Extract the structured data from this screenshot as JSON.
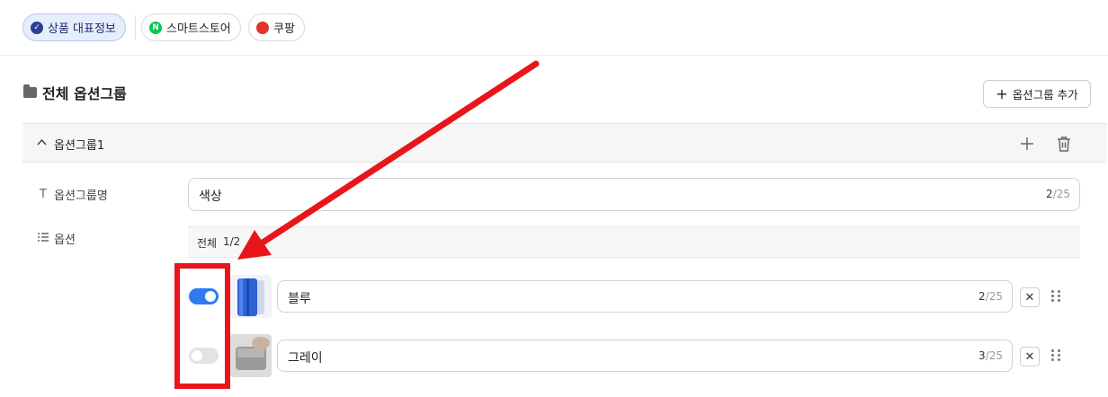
{
  "tabs": [
    {
      "label": "상품 대표정보",
      "icon": "check-circle-icon",
      "active": true
    },
    {
      "label": "스마트스토어",
      "icon": "naver-n-icon",
      "active": false
    },
    {
      "label": "쿠팡",
      "icon": "coupang-logo-icon",
      "active": false
    }
  ],
  "section": {
    "title": "전체 옵션그룹",
    "add_button": "옵션그룹 추가"
  },
  "group": {
    "name": "옵션그룹1"
  },
  "fields": {
    "name_label": "옵션그룹명",
    "options_label": "옵션",
    "name_value": "색상",
    "name_count": "2",
    "name_max": "/25"
  },
  "options_list": {
    "all_label": "전체",
    "count": "1/2"
  },
  "options": [
    {
      "label": "블루",
      "enabled": true,
      "count": "2",
      "max": "/25"
    },
    {
      "label": "그레이",
      "enabled": false,
      "count": "3",
      "max": "/25"
    }
  ],
  "colors": {
    "accent": "#2e7bf0",
    "annotation": "#e8161b",
    "active_tab_bg": "#e6eefc"
  }
}
